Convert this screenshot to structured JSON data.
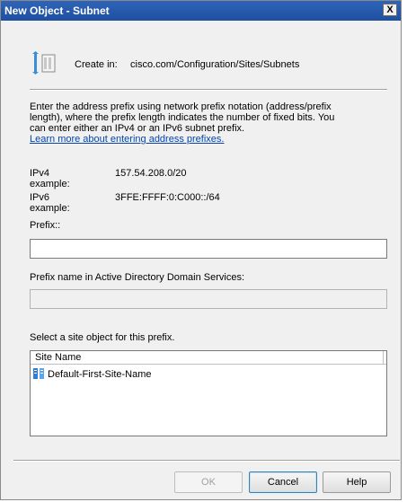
{
  "window": {
    "title": "New Object - Subnet",
    "close_label": "X"
  },
  "header": {
    "icon": "subnet-folder-icon",
    "created_label": "Create in:",
    "created_path": "cisco.com/Configuration/Sites/Subnets"
  },
  "description": {
    "lines": [
      "Enter the address prefix using network prefix notation (address/prefix",
      "length), where the prefix length indicates the number of fixed bits. You",
      "can enter either an IPv4 or an IPv6 subnet prefix."
    ],
    "link": "Learn more about entering address prefixes."
  },
  "examples": {
    "ipv4_label": "IPv4 example:",
    "ipv4_value": "157.54.208.0/20",
    "ipv6_label": "IPv6 example:",
    "ipv6_value": "3FFE:FFFF:0:C000::/64"
  },
  "prefix": {
    "label": "Prefix::",
    "value": ""
  },
  "prefix_name": {
    "label": "Prefix name in Active Directory Domain Services:",
    "value": ""
  },
  "site_list": {
    "label": "Select a site object for this prefix.",
    "column": "Site Name",
    "items": [
      {
        "name": "Default-First-Site-Name",
        "icon": "site-icon"
      }
    ]
  },
  "buttons": {
    "ok": "OK",
    "cancel": "Cancel",
    "help": "Help"
  },
  "colors": {
    "titlebar": "#2e64b8",
    "link": "#0645ad",
    "dialog_bg": "#f0f0f0"
  }
}
